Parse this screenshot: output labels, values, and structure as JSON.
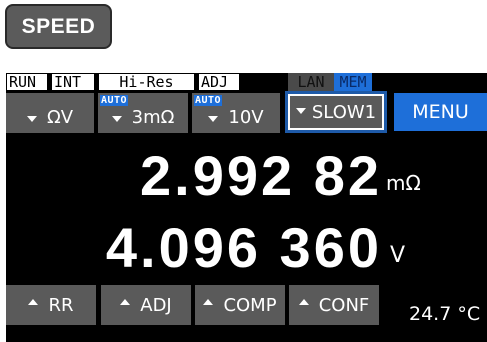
{
  "speed_key": {
    "label": "SPEED"
  },
  "status": {
    "run": "RUN",
    "int": "INT",
    "resolution": "Hi-Res",
    "adj": "ADJ",
    "lan": "LAN",
    "mem": "MEM"
  },
  "controls": {
    "function": {
      "label": "ΩV"
    },
    "range_r": {
      "badge": "AUTO",
      "label": "3mΩ"
    },
    "range_v": {
      "badge": "AUTO",
      "label": "10V"
    },
    "speed": {
      "label": "SLOW1"
    },
    "menu": {
      "label": "MENU"
    }
  },
  "measurement": {
    "resistance": {
      "value": "2.992 82",
      "unit": "mΩ"
    },
    "voltage": {
      "value": "4.096 360",
      "unit": "V"
    }
  },
  "bottom_buttons": {
    "rr": "RR",
    "adj": "ADJ",
    "comp": "COMP",
    "conf": "CONF"
  },
  "temperature": {
    "value": "24.7 °C"
  },
  "colors": {
    "accent_blue": "#1e6fd9",
    "button_gray": "#5a5a5a",
    "highlight_border": "#1e5aa8"
  }
}
